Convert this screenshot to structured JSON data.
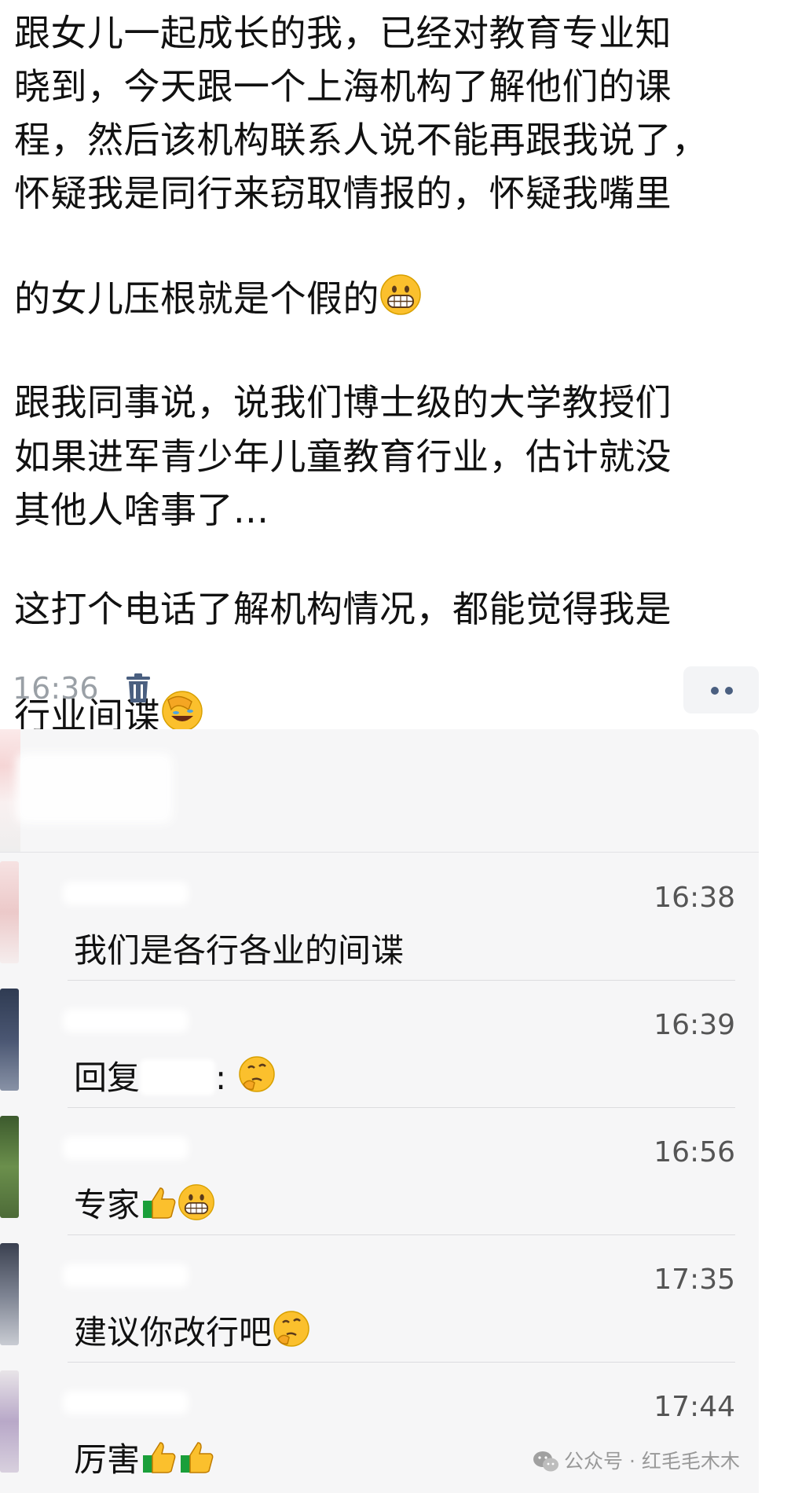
{
  "post": {
    "paragraphs": [
      "跟女儿一起成长的我，已经对教育专业知\n晓到，今天跟一个上海机构了解他们的课\n程，然后该机构联系人说不能再跟我说了，\n怀疑我是同行来窃取情报的，怀疑我嘴里\n的女儿压根就是个假的",
      "跟我同事说，说我们博士级的大学教授们\n如果进军青少年儿童教育行业，估计就没\n其他人啥事了...",
      "这打个电话了解机构情况，都能觉得我是\n行业间谍"
    ],
    "emojis": [
      "grinning-face-emoji",
      "facepalm-laughing-emoji"
    ],
    "time": "16:36"
  },
  "icons": {
    "trash": "trash-icon",
    "more": "more-dots-icon"
  },
  "colors": {
    "comments_bg": "#f6f6f7",
    "emoji_yellow": "#fbc02d",
    "thumb_sleeve": "#1a9f3a",
    "more_dots": "#4a5f80"
  },
  "comments": [
    {
      "time": "16:38",
      "text": "我们是各行各业的间谍"
    },
    {
      "time": "16:39",
      "text_prefix": "回复",
      "text_suffix": ":"
    },
    {
      "time": "16:56",
      "text": "专家"
    },
    {
      "time": "17:35",
      "text": "建议你改行吧"
    },
    {
      "time": "17:44",
      "text": "厉害"
    }
  ],
  "watermark": {
    "text": "公众号 · 红毛毛木木"
  }
}
